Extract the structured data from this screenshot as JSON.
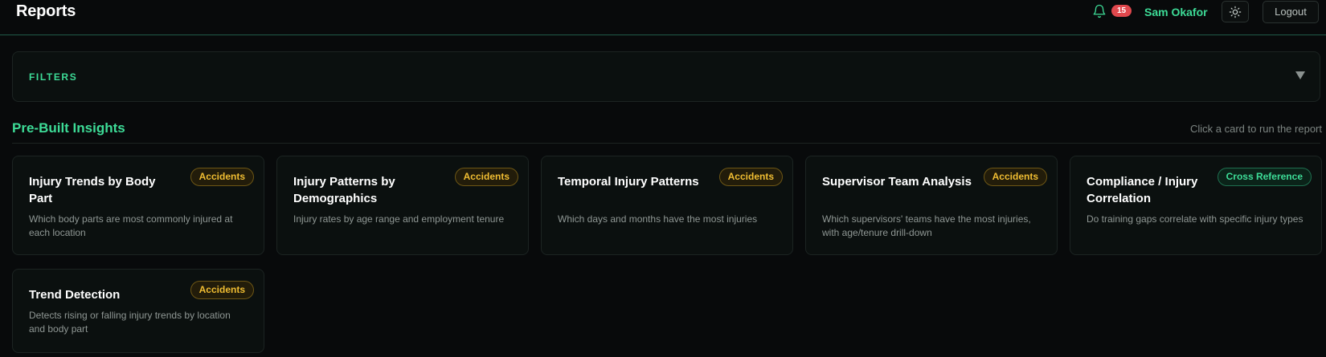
{
  "header": {
    "title": "Reports",
    "notification_count": "15",
    "user_name": "Sam Okafor",
    "logout_label": "Logout"
  },
  "filters": {
    "label": "FILTERS"
  },
  "insights": {
    "title": "Pre-Built Insights",
    "hint": "Click a card to run the report",
    "cards": [
      {
        "title": "Injury Trends by Body Part",
        "badge": "Accidents",
        "description": "Which body parts are most commonly injured at each location"
      },
      {
        "title": "Injury Patterns by Demographics",
        "badge": "Accidents",
        "description": "Injury rates by age range and employment tenure"
      },
      {
        "title": "Temporal Injury Patterns",
        "badge": "Accidents",
        "description": "Which days and months have the most injuries"
      },
      {
        "title": "Supervisor Team Analysis",
        "badge": "Accidents",
        "description": "Which supervisors' teams have the most injuries, with age/tenure drill-down"
      },
      {
        "title": "Compliance / Injury Correlation",
        "badge": "Cross Reference",
        "description": "Do training gaps correlate with specific injury types"
      },
      {
        "title": "Trend Detection",
        "badge": "Accidents",
        "description": "Detects rising or falling injury trends by location and body part"
      }
    ]
  },
  "colors": {
    "accent": "#3ddc97",
    "background": "#080a0b",
    "badge_accidents": "#f0bd32",
    "notification": "#e0484d"
  },
  "icons": {
    "notifications": "bell-icon",
    "theme_toggle": "sun-icon",
    "filters_toggle": "caret-down-icon"
  }
}
